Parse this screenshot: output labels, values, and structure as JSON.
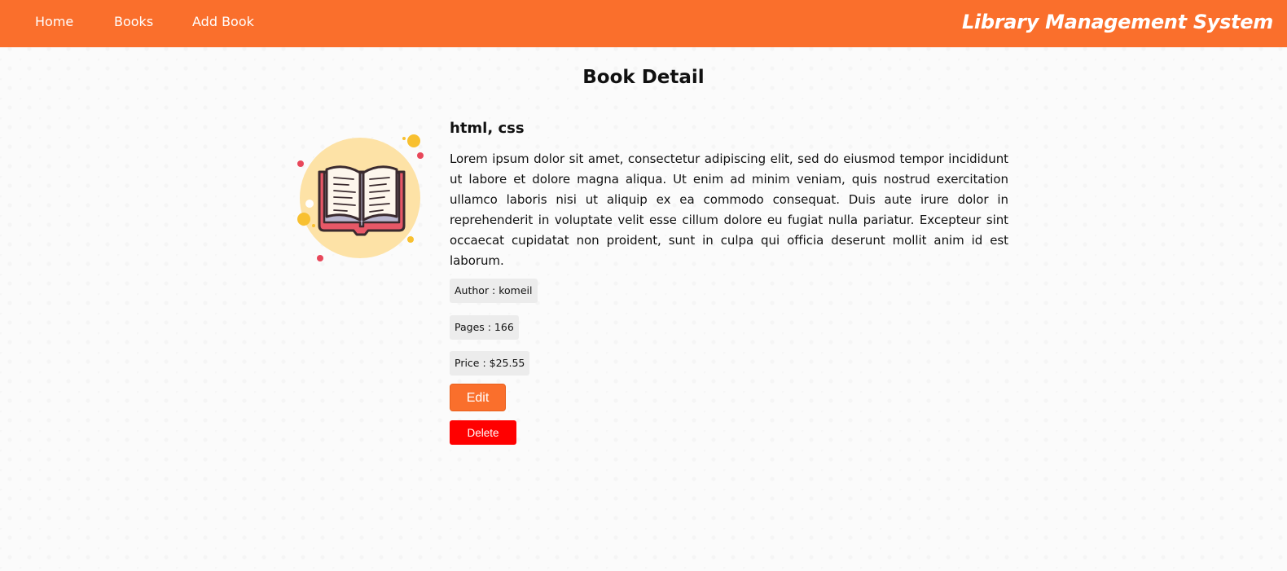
{
  "nav": {
    "home": "Home",
    "books": "Books",
    "add_book": "Add Book",
    "brand": "Library Management System"
  },
  "page": {
    "title": "Book Detail"
  },
  "book": {
    "title": "html, css",
    "description": "Lorem ipsum dolor sit amet, consectetur adipiscing elit, sed do eiusmod tempor incididunt ut labore et dolore magna aliqua. Ut enim ad minim veniam, quis nostrud exercitation ullamco laboris nisi ut aliquip ex ea commodo consequat. Duis aute irure dolor in reprehenderit in voluptate velit esse cillum dolore eu fugiat nulla pariatur. Excepteur sint occaecat cupidatat non proident, sunt in culpa qui officia deserunt mollit anim id est laborum.",
    "author": "Author : komeil",
    "pages": "Pages : 166",
    "price": "Price : $25.55",
    "icon": "open-book-icon"
  },
  "actions": {
    "edit": "Edit",
    "delete": "Delete"
  },
  "colors": {
    "primary": "#fa6f2c",
    "danger": "#ff0000",
    "tag_bg": "#ececec",
    "circle": "#fde2a6"
  }
}
